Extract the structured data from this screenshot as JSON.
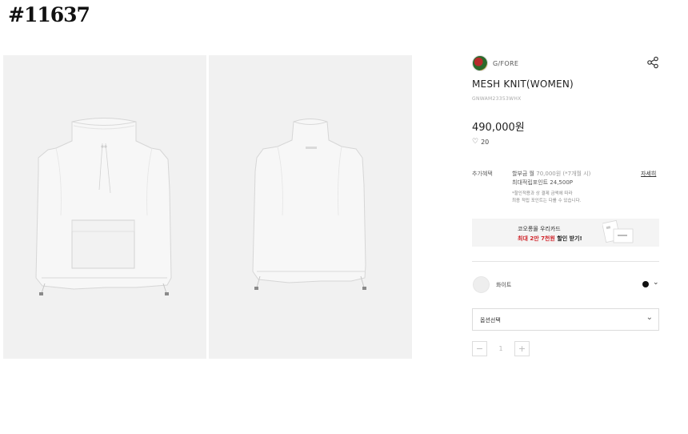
{
  "listing": {
    "tag_id": "#11637"
  },
  "gallery": {
    "images": [
      {
        "label": "front"
      },
      {
        "label": "back"
      }
    ]
  },
  "product": {
    "brand": "G/FORE",
    "title": "MESH KNIT(WOMEN)",
    "code": "GNWAM23353WHX",
    "price": "490,000원",
    "likes": "20"
  },
  "benefits": {
    "label": "추가혜택",
    "installment_prefix": "할부금 월",
    "installment_value": "70,000원 (*7개월 시)",
    "points": "최대적립포인트 24,500P",
    "note_line1": "*할인적용과 상 결제 금액에 따라",
    "note_line2": "최종 적립 포인트는 다를 수 있습니다.",
    "more": "자세히"
  },
  "card_banner": {
    "line1": "코오롱몰 우리카드",
    "highlight": "최대 2만 7천원",
    "suffix": "할인 받기!"
  },
  "color_option": {
    "name": "화이트",
    "dot_color": "#111111"
  },
  "option_select": {
    "placeholder": "옵션선택"
  },
  "quantity": {
    "minus": "−",
    "value": "1",
    "plus": "+"
  },
  "icons": {
    "share": "share-icon",
    "heart": "heart-icon",
    "chevron": "chevron-down-icon"
  }
}
